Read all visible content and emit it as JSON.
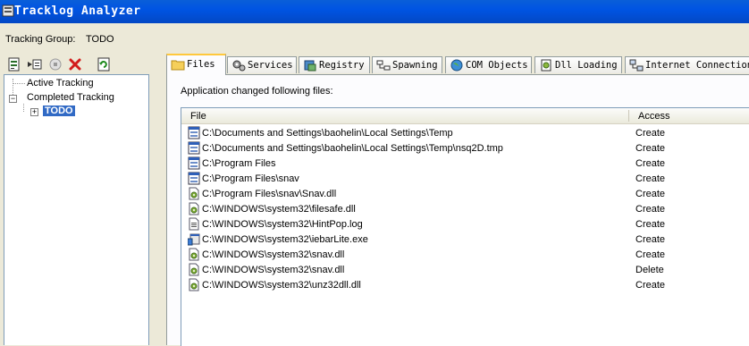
{
  "window": {
    "title": "Tracklog Analyzer"
  },
  "tracking_group": {
    "label": "Tracking Group:",
    "value": "TODO"
  },
  "toolbar": {
    "buttons": [
      {
        "icon": "new-tracking-icon"
      },
      {
        "icon": "start-tracking-icon"
      },
      {
        "icon": "stop-icon",
        "disabled": true
      },
      {
        "icon": "delete-icon"
      },
      {
        "icon": "refresh-icon"
      }
    ]
  },
  "tree": {
    "active": "Active Tracking",
    "completed": "Completed Tracking",
    "child": "TODO",
    "expand_minus": "−",
    "expand_plus": "+"
  },
  "tabs": [
    {
      "label": "Files",
      "icon": "folder-icon",
      "active": true
    },
    {
      "label": "Services",
      "icon": "gears-icon"
    },
    {
      "label": "Registry",
      "icon": "registry-icon"
    },
    {
      "label": "Spawning",
      "icon": "process-tree-icon"
    },
    {
      "label": "COM Objects",
      "icon": "globe-icon"
    },
    {
      "label": "Dll Loading",
      "icon": "dll-icon"
    },
    {
      "label": "Internet Connection",
      "icon": "network-icon"
    }
  ],
  "panel": {
    "caption": "Application changed following files:",
    "columns": {
      "file": "File",
      "access": "Access"
    },
    "rows": [
      {
        "icon": "folder-window-icon",
        "file": "C:\\Documents and Settings\\baohelin\\Local Settings\\Temp",
        "access": "Create"
      },
      {
        "icon": "folder-window-icon",
        "file": "C:\\Documents and Settings\\baohelin\\Local Settings\\Temp\\nsq2D.tmp",
        "access": "Create"
      },
      {
        "icon": "folder-window-icon",
        "file": "C:\\Program Files",
        "access": "Create"
      },
      {
        "icon": "folder-window-icon",
        "file": "C:\\Program Files\\snav",
        "access": "Create"
      },
      {
        "icon": "dll-file-icon",
        "file": "C:\\Program Files\\snav\\Snav.dll",
        "access": "Create"
      },
      {
        "icon": "dll-file-icon",
        "file": "C:\\WINDOWS\\system32\\filesafe.dll",
        "access": "Create"
      },
      {
        "icon": "text-file-icon",
        "file": "C:\\WINDOWS\\system32\\HintPop.log",
        "access": "Create"
      },
      {
        "icon": "exe-file-icon",
        "file": "C:\\WINDOWS\\system32\\iebarLite.exe",
        "access": "Create"
      },
      {
        "icon": "dll-file-icon",
        "file": "C:\\WINDOWS\\system32\\snav.dll",
        "access": "Create"
      },
      {
        "icon": "dll-file-icon",
        "file": "C:\\WINDOWS\\system32\\snav.dll",
        "access": "Delete"
      },
      {
        "icon": "dll-file-icon",
        "file": "C:\\WINDOWS\\system32\\unz32dll.dll",
        "access": "Create"
      }
    ]
  }
}
